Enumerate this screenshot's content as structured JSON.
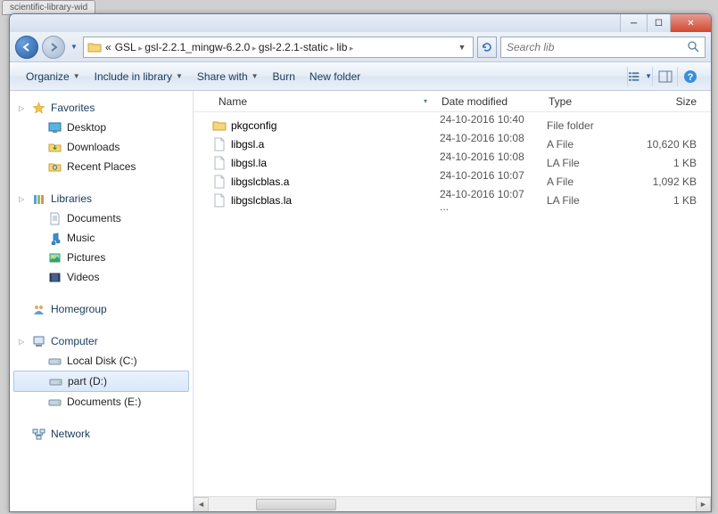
{
  "title_tab": "scientific-library-wid",
  "breadcrumbs": [
    "GSL",
    "gsl-2.2.1_mingw-6.2.0",
    "gsl-2.2.1-static",
    "lib"
  ],
  "breadcrumb_prefix": "«",
  "search": {
    "placeholder": "Search lib"
  },
  "toolbar": {
    "organize": "Organize",
    "include": "Include in library",
    "share": "Share with",
    "burn": "Burn",
    "newfolder": "New folder"
  },
  "columns": {
    "name": "Name",
    "date": "Date modified",
    "type": "Type",
    "size": "Size"
  },
  "nav": {
    "favorites": {
      "label": "Favorites",
      "items": [
        "Desktop",
        "Downloads",
        "Recent Places"
      ]
    },
    "libraries": {
      "label": "Libraries",
      "items": [
        "Documents",
        "Music",
        "Pictures",
        "Videos"
      ]
    },
    "homegroup": {
      "label": "Homegroup"
    },
    "computer": {
      "label": "Computer",
      "items": [
        "Local Disk (C:)",
        "part (D:)",
        "Documents (E:)"
      ],
      "selected": 1
    },
    "network": {
      "label": "Network"
    }
  },
  "files": [
    {
      "icon": "folder",
      "name": "pkgconfig",
      "date": "24-10-2016 10:40 ...",
      "type": "File folder",
      "size": ""
    },
    {
      "icon": "file",
      "name": "libgsl.a",
      "date": "24-10-2016 10:08 ...",
      "type": "A File",
      "size": "10,620 KB"
    },
    {
      "icon": "file",
      "name": "libgsl.la",
      "date": "24-10-2016 10:08 ...",
      "type": "LA File",
      "size": "1 KB"
    },
    {
      "icon": "file",
      "name": "libgslcblas.a",
      "date": "24-10-2016 10:07 ...",
      "type": "A File",
      "size": "1,092 KB"
    },
    {
      "icon": "file",
      "name": "libgslcblas.la",
      "date": "24-10-2016 10:07 ...",
      "type": "LA File",
      "size": "1 KB"
    }
  ]
}
